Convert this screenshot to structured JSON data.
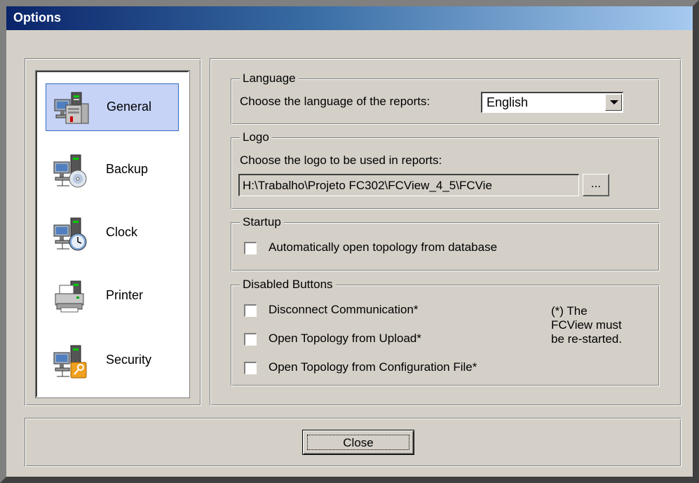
{
  "window": {
    "title": "Options"
  },
  "nav": {
    "items": [
      {
        "label": "General",
        "icon": "general-computer-icon",
        "selected": true
      },
      {
        "label": "Backup",
        "icon": "backup-disc-icon",
        "selected": false
      },
      {
        "label": "Clock",
        "icon": "clock-icon",
        "selected": false
      },
      {
        "label": "Printer",
        "icon": "printer-icon",
        "selected": false
      },
      {
        "label": "Security",
        "icon": "security-key-icon",
        "selected": false
      }
    ]
  },
  "language": {
    "legend": "Language",
    "prompt": "Choose the language of the reports:",
    "selected": "English"
  },
  "logo": {
    "legend": "Logo",
    "prompt": "Choose the logo to be used in reports:",
    "path": "H:\\Trabalho\\Projeto FC302\\FCView_4_5\\FCVie",
    "browse_label": "..."
  },
  "startup": {
    "legend": "Startup",
    "auto_open_label": "Automatically open topology from database",
    "auto_open_checked": false
  },
  "disabled_buttons": {
    "legend": "Disabled Buttons",
    "options": [
      {
        "label": "Disconnect Communication*",
        "checked": false
      },
      {
        "label": "Open Topology from Upload*",
        "checked": false
      },
      {
        "label": "Open Topology from Configuration File*",
        "checked": false
      }
    ],
    "note_line1": "(*) The",
    "note_line2": "FCView must",
    "note_line3": "be re-started."
  },
  "footer": {
    "close_label": "Close"
  },
  "colors": {
    "face": "#d4d0c8",
    "title_start": "#0a246a",
    "title_end": "#a6caf0",
    "selection": "#c6d3f7",
    "selection_border": "#316ac5"
  }
}
